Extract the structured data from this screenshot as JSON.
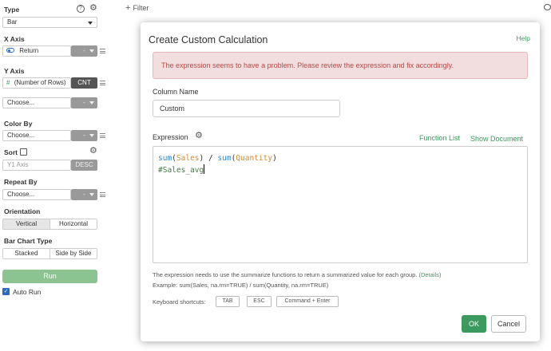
{
  "sidebar": {
    "type_label": "Type",
    "type_value": "Bar",
    "x_axis_label": "X Axis",
    "x_axis_value": "Return",
    "x_axis_agg": "-",
    "y_axis_label": "Y Axis",
    "y_axis_value": "(Number of Rows)",
    "y_axis_agg": "CNT",
    "y_axis2_placeholder": "Choose...",
    "y_axis2_agg": "-",
    "color_by_label": "Color By",
    "color_by_placeholder": "Choose...",
    "color_by_agg": "-",
    "sort_label": "Sort",
    "sort_field": "Y1 Axis",
    "sort_order": "DESC",
    "repeat_by_label": "Repeat By",
    "repeat_by_placeholder": "Choose...",
    "repeat_by_agg": "-",
    "orientation_label": "Orientation",
    "orientation_options": [
      "Vertical",
      "Horizontal"
    ],
    "bar_chart_type_label": "Bar Chart Type",
    "bar_chart_type_options": [
      "Stacked",
      "Side by Side"
    ],
    "run_label": "Run",
    "auto_run_label": "Auto Run"
  },
  "topbar": {
    "filter_label": "Filter"
  },
  "modal": {
    "title": "Create Custom Calculation",
    "help_label": "Help",
    "alert_text": "The expression seems to have a problem. Please review the expression and fix accordingly.",
    "column_name_label": "Column Name",
    "column_name_value": "Custom",
    "expression_label": "Expression",
    "function_list_label": "Function List",
    "show_document_label": "Show Document",
    "expression_line1": {
      "fn1": "sum",
      "open1": "(",
      "arg1": "Sales",
      "close1": ")",
      "op": " / ",
      "fn2": "sum",
      "open2": "(",
      "arg2": "Quantity",
      "close2": ")"
    },
    "expression_line2": "#Sales_avg",
    "note_text": "The expression needs to use the summarize functions to return a summarized value for each group.",
    "details_label": "(Details)",
    "example_text": "Example: sum(Sales, na.rm=TRUE) / sum(Quantity, na.rm=TRUE)",
    "shortcuts_label": "Keyboard shortcuts:",
    "shortcuts": [
      "TAB",
      "ESC",
      "Command + Enter"
    ],
    "ok_label": "OK",
    "cancel_label": "Cancel"
  },
  "colors": {
    "accent_green": "#3c9a5f",
    "alert_bg": "#f2dede",
    "alert_text": "#b94a48",
    "run_button": "#8bc391",
    "code_function": "#3b87c4",
    "code_argument": "#d18b30"
  }
}
